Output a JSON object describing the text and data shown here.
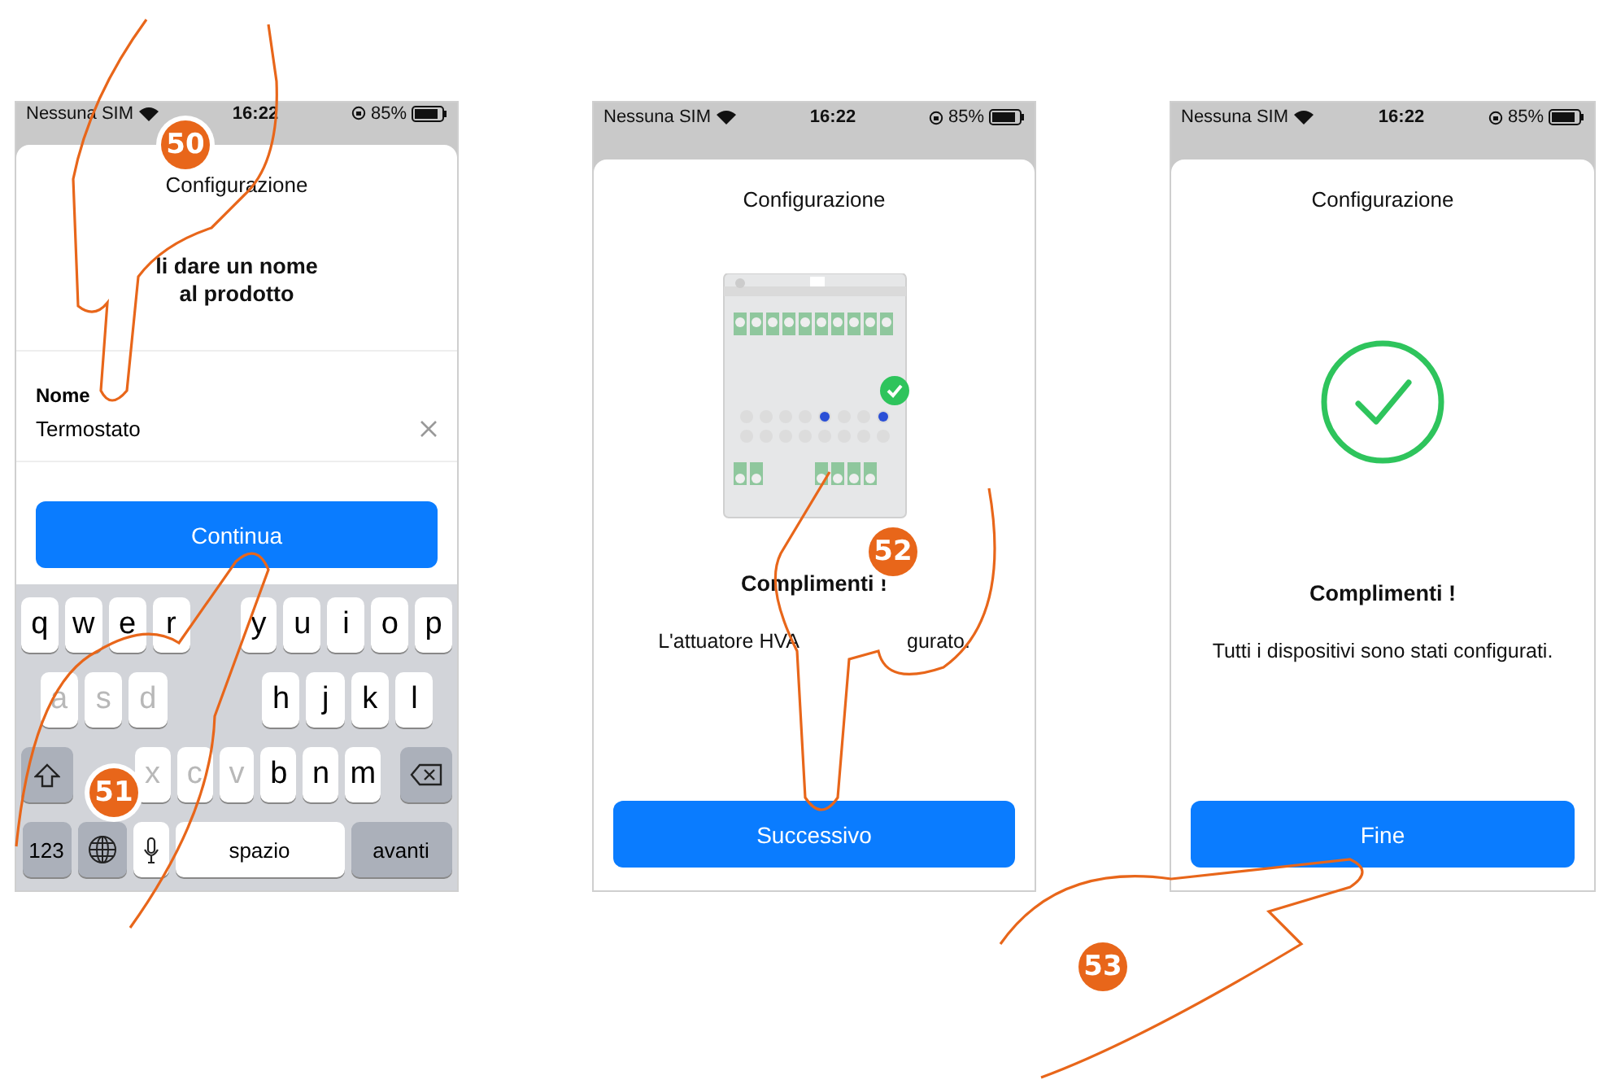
{
  "screens": [
    {
      "kind": "name_entry",
      "status": {
        "carrier": "Nessuna SIM",
        "time": "16:22",
        "battery": "85%"
      },
      "title": "Configurazione",
      "heading": [
        "li dare un nome",
        "al prodotto"
      ],
      "field": {
        "label": "Nome",
        "value": "Termostato"
      },
      "button": "Continua",
      "keyboard": {
        "rows": [
          [
            {
              "kind": "letter",
              "label": "q"
            },
            {
              "kind": "letter",
              "label": "w"
            },
            {
              "kind": "letter",
              "label": "e"
            },
            {
              "kind": "letter",
              "label": "r"
            },
            {
              "kind": "covered"
            },
            {
              "kind": "letter",
              "label": "y"
            },
            {
              "kind": "letter",
              "label": "u"
            },
            {
              "kind": "letter",
              "label": "i"
            },
            {
              "kind": "letter",
              "label": "o"
            },
            {
              "kind": "letter",
              "label": "p"
            }
          ],
          [
            {
              "kind": "letter",
              "label": "a",
              "faded": true
            },
            {
              "kind": "letter",
              "label": "s",
              "faded": true
            },
            {
              "kind": "letter",
              "label": "d",
              "faded": true
            },
            {
              "kind": "covered"
            },
            {
              "kind": "covered"
            },
            {
              "kind": "letter",
              "label": "h"
            },
            {
              "kind": "letter",
              "label": "j"
            },
            {
              "kind": "letter",
              "label": "k"
            },
            {
              "kind": "letter",
              "label": "l"
            }
          ],
          [
            {
              "kind": "shift"
            },
            {
              "kind": "covered"
            },
            {
              "kind": "letter",
              "label": "x",
              "faded": true
            },
            {
              "kind": "letter",
              "label": "c",
              "faded": true
            },
            {
              "kind": "letter",
              "label": "v",
              "faded": true
            },
            {
              "kind": "letter",
              "label": "b"
            },
            {
              "kind": "letter",
              "label": "n"
            },
            {
              "kind": "letter",
              "label": "m"
            },
            {
              "kind": "backspace"
            }
          ]
        ],
        "bottom_row": [
          {
            "kind": "mode",
            "label": "123"
          },
          {
            "kind": "globe"
          },
          {
            "kind": "mic"
          },
          {
            "kind": "space",
            "label": "spazio"
          },
          {
            "kind": "return",
            "label": "avanti"
          }
        ]
      }
    },
    {
      "kind": "device_done",
      "status": {
        "carrier": "Nessuna SIM",
        "time": "16:22",
        "battery": "85%"
      },
      "title": "Configurazione",
      "heading": [
        "Complimenti !"
      ],
      "message": [
        "L'attuatore HVA",
        "gurato."
      ],
      "button": "Successivo"
    },
    {
      "kind": "all_done",
      "status": {
        "carrier": "Nessuna SIM",
        "time": "16:22",
        "battery": "85%"
      },
      "title": "Configurazione",
      "heading": [
        "Complimenti !"
      ],
      "message": [
        "Tutti i dispositivi sono stati configurati."
      ],
      "button": "Fine"
    }
  ],
  "step_badges": [
    "50",
    "51",
    "52",
    "53"
  ]
}
